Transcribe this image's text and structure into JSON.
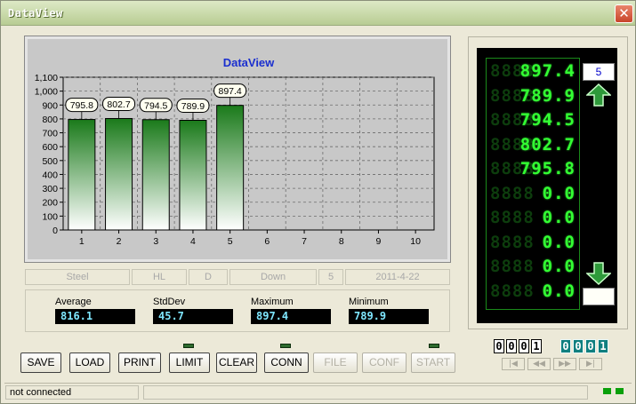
{
  "window": {
    "title": "DataView",
    "close_glyph": "✕"
  },
  "chart": {
    "title": "DataView",
    "title_color": "#1a2fcf",
    "bar_color_top": "#1a7a1a",
    "bar_color_bottom": "#ffffff",
    "plot_bg": "#c8c8c8",
    "y_ticks": [
      "0",
      "100",
      "200",
      "300",
      "400",
      "500",
      "600",
      "700",
      "800",
      "900",
      "1,000",
      "1,100"
    ],
    "x_ticks": [
      "1",
      "2",
      "3",
      "4",
      "5",
      "6",
      "7",
      "8",
      "9",
      "10"
    ]
  },
  "chart_data": {
    "type": "bar",
    "title": "DataView",
    "categories": [
      "1",
      "2",
      "3",
      "4",
      "5",
      "6",
      "7",
      "8",
      "9",
      "10"
    ],
    "values": [
      795.8,
      802.7,
      794.5,
      789.9,
      897.4
    ],
    "data_labels": [
      "795.8",
      "802.7",
      "794.5",
      "789.9",
      "897.4"
    ],
    "ylim": [
      0,
      1100
    ],
    "grid": true
  },
  "info_row": [
    "Steel",
    "HL",
    "D",
    "Down",
    "5",
    "2011-4-22"
  ],
  "stats": {
    "average": {
      "label": "Average",
      "value": "816.1"
    },
    "stddev": {
      "label": "StdDev",
      "value": "45.7"
    },
    "maximum": {
      "label": "Maximum",
      "value": "897.4"
    },
    "minimum": {
      "label": "Minimum",
      "value": "789.9"
    }
  },
  "buttons": {
    "save": "SAVE",
    "load": "LOAD",
    "print": "PRINT",
    "limit": "LIMIT",
    "clear": "CLEAR",
    "conn": "CONN",
    "file": "FILE",
    "conf": "CONF",
    "start": "START"
  },
  "readings": {
    "ghost": "8888",
    "values": [
      "897.4",
      "789.9",
      "794.5",
      "802.7",
      "795.8",
      "0.0",
      "0.0",
      "0.0",
      "0.0",
      "0.0"
    ]
  },
  "count_box": "5",
  "counter_left": [
    "0",
    "0",
    "0",
    "1"
  ],
  "counter_right": [
    "0",
    "0",
    "0",
    "1"
  ],
  "nav": {
    "first": "|◀",
    "prev": "◀◀",
    "next": "▶▶",
    "last": "▶|"
  },
  "icons": {
    "up": "arrow-up-icon",
    "down": "arrow-down-icon",
    "close": "close-icon"
  },
  "status": {
    "text": "not connected",
    "led_color": "#0aa00a"
  }
}
